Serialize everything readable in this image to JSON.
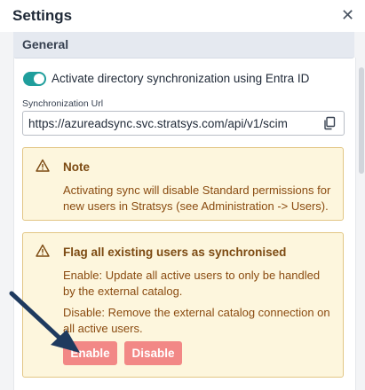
{
  "header": {
    "title": "Settings",
    "close_icon": "close-icon"
  },
  "section": {
    "title": "General"
  },
  "sync_toggle": {
    "label": "Activate directory synchronization using Entra ID",
    "checked": true,
    "color": "#1f9e9c"
  },
  "sync_url": {
    "label": "Synchronization Url",
    "value": "https://azureadsync.svc.stratsys.com/api/v1/scim",
    "copy_icon": "copy-icon"
  },
  "note": {
    "icon": "warning-icon",
    "title": "Note",
    "text": "Activating sync will disable Standard permissions for new users in Stratsys (see Administration -> Users)."
  },
  "flag": {
    "icon": "warning-icon",
    "title": "Flag all existing users as synchronised",
    "enable_text": "Enable: Update all active users to only be handled by the external catalog.",
    "disable_text": "Disable: Remove the external catalog connection on all active users.",
    "enable_label": "Enable",
    "disable_label": "Disable",
    "button_color": "#f28886"
  },
  "colors": {
    "alert_bg": "#fdf6dd",
    "alert_border": "#e2c685",
    "alert_text": "#8a4b10",
    "annotation_arrow": "#1e3a5f"
  }
}
